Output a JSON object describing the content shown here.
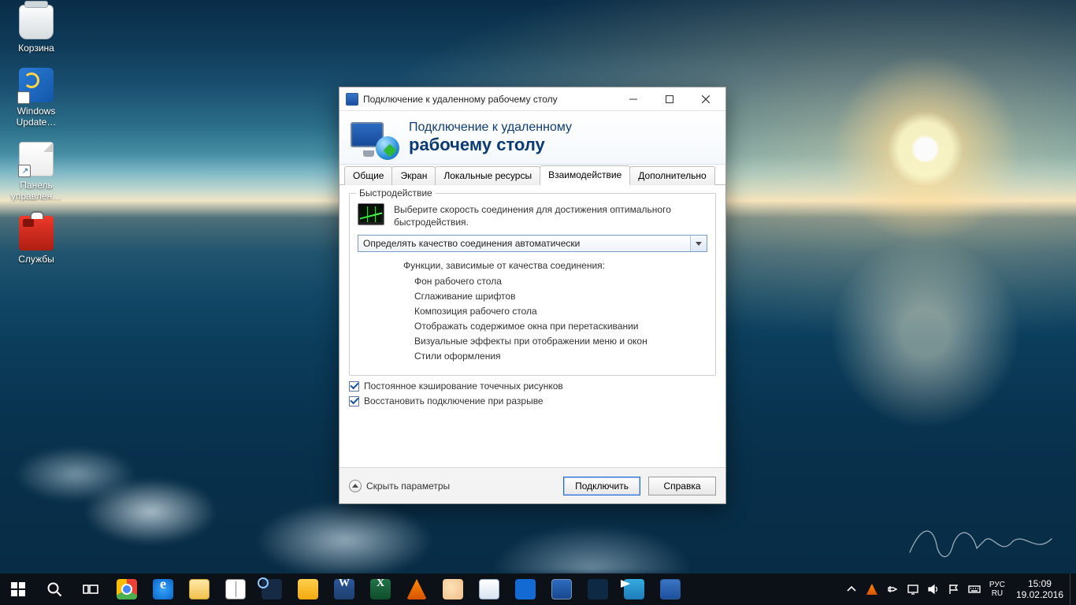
{
  "desktop_icons": [
    {
      "id": "recycle-bin",
      "label": "Корзина"
    },
    {
      "id": "windows-update",
      "label": "Windows Update…"
    },
    {
      "id": "control-panel",
      "label": "Панель управлен…"
    },
    {
      "id": "services",
      "label": "Службы"
    }
  ],
  "dialog": {
    "title": "Подключение к удаленному рабочему столу",
    "banner_line1": "Подключение к удаленному",
    "banner_line2": "рабочему столу",
    "tabs": {
      "general": "Общие",
      "display": "Экран",
      "local": "Локальные ресурсы",
      "experience": "Взаимодействие",
      "advanced": "Дополнительно"
    },
    "group_legend": "Быстродействие",
    "instruction": "Выберите скорость соединения для достижения оптимального быстродействия.",
    "combo_value": "Определять качество соединения автоматически",
    "funcs_label": "Функции, зависимые от качества соединения:",
    "funcs": [
      "Фон рабочего стола",
      "Сглаживание шрифтов",
      "Композиция рабочего стола",
      "Отображать содержимое окна при перетаскивании",
      "Визуальные эффекты при отображении меню и окон",
      "Стили оформления"
    ],
    "chk_bitmap": "Постоянное кэширование точечных рисунков",
    "chk_reconnect": "Восстановить подключение при разрыве",
    "hide_params": "Скрыть параметры",
    "btn_connect": "Подключить",
    "btn_help": "Справка"
  },
  "tray": {
    "lang1": "РУС",
    "lang2": "RU",
    "time": "15:09",
    "date": "19.02.2016"
  }
}
